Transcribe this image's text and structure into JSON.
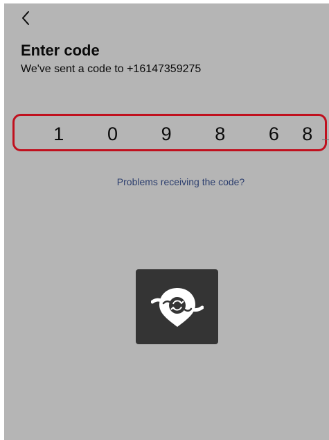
{
  "header": {
    "back_icon": "chevron-left-icon",
    "title": "Enter code",
    "subtitle": "We've sent a code to +16147359275"
  },
  "code": {
    "digits": [
      "1",
      "0",
      "9",
      "8",
      "6",
      "8"
    ]
  },
  "help_link": "Problems receiving the code?",
  "logo": {
    "icon": "location-sync-pin-icon"
  },
  "colors": {
    "background": "#b5b5b5",
    "highlight_border": "#c0101e",
    "link": "#2c3e6e",
    "logo_tile": "#343434"
  }
}
